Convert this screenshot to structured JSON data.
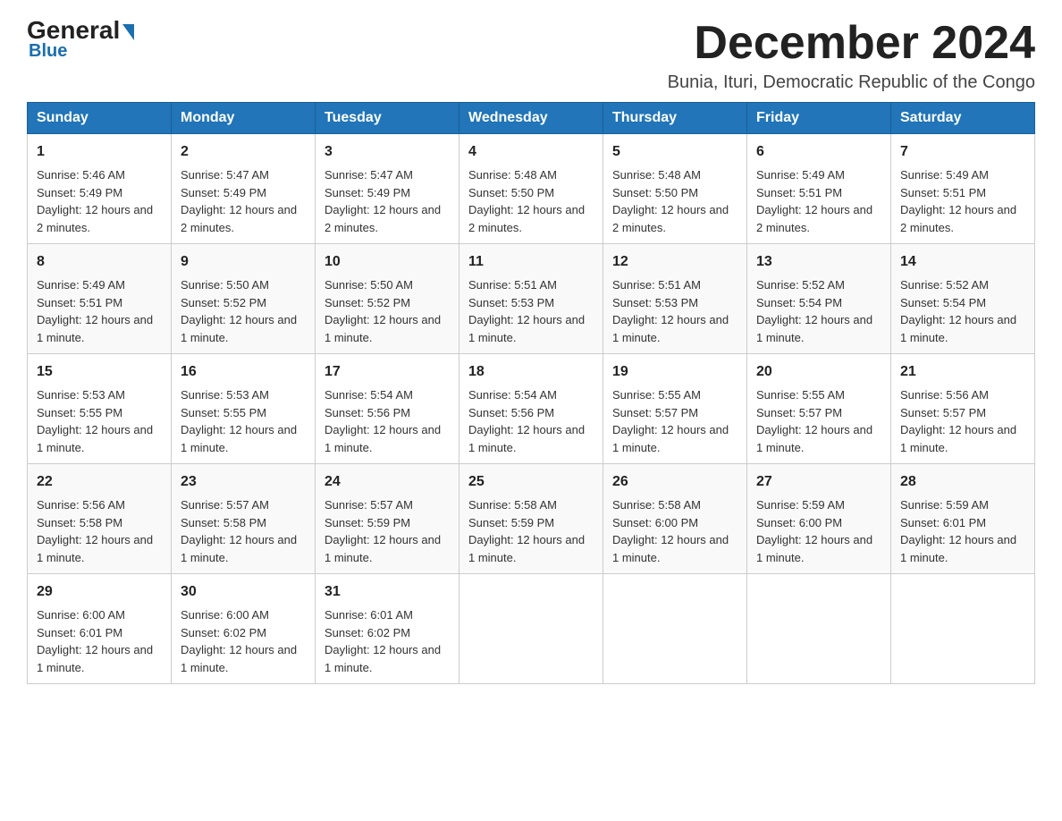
{
  "logo": {
    "part1": "General",
    "part2": "Blue"
  },
  "title": "December 2024",
  "subtitle": "Bunia, Ituri, Democratic Republic of the Congo",
  "days_of_week": [
    "Sunday",
    "Monday",
    "Tuesday",
    "Wednesday",
    "Thursday",
    "Friday",
    "Saturday"
  ],
  "weeks": [
    [
      {
        "day": "1",
        "sunrise": "5:46 AM",
        "sunset": "5:49 PM",
        "daylight": "12 hours and 2 minutes."
      },
      {
        "day": "2",
        "sunrise": "5:47 AM",
        "sunset": "5:49 PM",
        "daylight": "12 hours and 2 minutes."
      },
      {
        "day": "3",
        "sunrise": "5:47 AM",
        "sunset": "5:49 PM",
        "daylight": "12 hours and 2 minutes."
      },
      {
        "day": "4",
        "sunrise": "5:48 AM",
        "sunset": "5:50 PM",
        "daylight": "12 hours and 2 minutes."
      },
      {
        "day": "5",
        "sunrise": "5:48 AM",
        "sunset": "5:50 PM",
        "daylight": "12 hours and 2 minutes."
      },
      {
        "day": "6",
        "sunrise": "5:49 AM",
        "sunset": "5:51 PM",
        "daylight": "12 hours and 2 minutes."
      },
      {
        "day": "7",
        "sunrise": "5:49 AM",
        "sunset": "5:51 PM",
        "daylight": "12 hours and 2 minutes."
      }
    ],
    [
      {
        "day": "8",
        "sunrise": "5:49 AM",
        "sunset": "5:51 PM",
        "daylight": "12 hours and 1 minute."
      },
      {
        "day": "9",
        "sunrise": "5:50 AM",
        "sunset": "5:52 PM",
        "daylight": "12 hours and 1 minute."
      },
      {
        "day": "10",
        "sunrise": "5:50 AM",
        "sunset": "5:52 PM",
        "daylight": "12 hours and 1 minute."
      },
      {
        "day": "11",
        "sunrise": "5:51 AM",
        "sunset": "5:53 PM",
        "daylight": "12 hours and 1 minute."
      },
      {
        "day": "12",
        "sunrise": "5:51 AM",
        "sunset": "5:53 PM",
        "daylight": "12 hours and 1 minute."
      },
      {
        "day": "13",
        "sunrise": "5:52 AM",
        "sunset": "5:54 PM",
        "daylight": "12 hours and 1 minute."
      },
      {
        "day": "14",
        "sunrise": "5:52 AM",
        "sunset": "5:54 PM",
        "daylight": "12 hours and 1 minute."
      }
    ],
    [
      {
        "day": "15",
        "sunrise": "5:53 AM",
        "sunset": "5:55 PM",
        "daylight": "12 hours and 1 minute."
      },
      {
        "day": "16",
        "sunrise": "5:53 AM",
        "sunset": "5:55 PM",
        "daylight": "12 hours and 1 minute."
      },
      {
        "day": "17",
        "sunrise": "5:54 AM",
        "sunset": "5:56 PM",
        "daylight": "12 hours and 1 minute."
      },
      {
        "day": "18",
        "sunrise": "5:54 AM",
        "sunset": "5:56 PM",
        "daylight": "12 hours and 1 minute."
      },
      {
        "day": "19",
        "sunrise": "5:55 AM",
        "sunset": "5:57 PM",
        "daylight": "12 hours and 1 minute."
      },
      {
        "day": "20",
        "sunrise": "5:55 AM",
        "sunset": "5:57 PM",
        "daylight": "12 hours and 1 minute."
      },
      {
        "day": "21",
        "sunrise": "5:56 AM",
        "sunset": "5:57 PM",
        "daylight": "12 hours and 1 minute."
      }
    ],
    [
      {
        "day": "22",
        "sunrise": "5:56 AM",
        "sunset": "5:58 PM",
        "daylight": "12 hours and 1 minute."
      },
      {
        "day": "23",
        "sunrise": "5:57 AM",
        "sunset": "5:58 PM",
        "daylight": "12 hours and 1 minute."
      },
      {
        "day": "24",
        "sunrise": "5:57 AM",
        "sunset": "5:59 PM",
        "daylight": "12 hours and 1 minute."
      },
      {
        "day": "25",
        "sunrise": "5:58 AM",
        "sunset": "5:59 PM",
        "daylight": "12 hours and 1 minute."
      },
      {
        "day": "26",
        "sunrise": "5:58 AM",
        "sunset": "6:00 PM",
        "daylight": "12 hours and 1 minute."
      },
      {
        "day": "27",
        "sunrise": "5:59 AM",
        "sunset": "6:00 PM",
        "daylight": "12 hours and 1 minute."
      },
      {
        "day": "28",
        "sunrise": "5:59 AM",
        "sunset": "6:01 PM",
        "daylight": "12 hours and 1 minute."
      }
    ],
    [
      {
        "day": "29",
        "sunrise": "6:00 AM",
        "sunset": "6:01 PM",
        "daylight": "12 hours and 1 minute."
      },
      {
        "day": "30",
        "sunrise": "6:00 AM",
        "sunset": "6:02 PM",
        "daylight": "12 hours and 1 minute."
      },
      {
        "day": "31",
        "sunrise": "6:01 AM",
        "sunset": "6:02 PM",
        "daylight": "12 hours and 1 minute."
      },
      null,
      null,
      null,
      null
    ]
  ],
  "labels": {
    "sunrise": "Sunrise:",
    "sunset": "Sunset:",
    "daylight": "Daylight:"
  },
  "colors": {
    "header_bg": "#2175b8",
    "accent": "#1a6faf"
  }
}
